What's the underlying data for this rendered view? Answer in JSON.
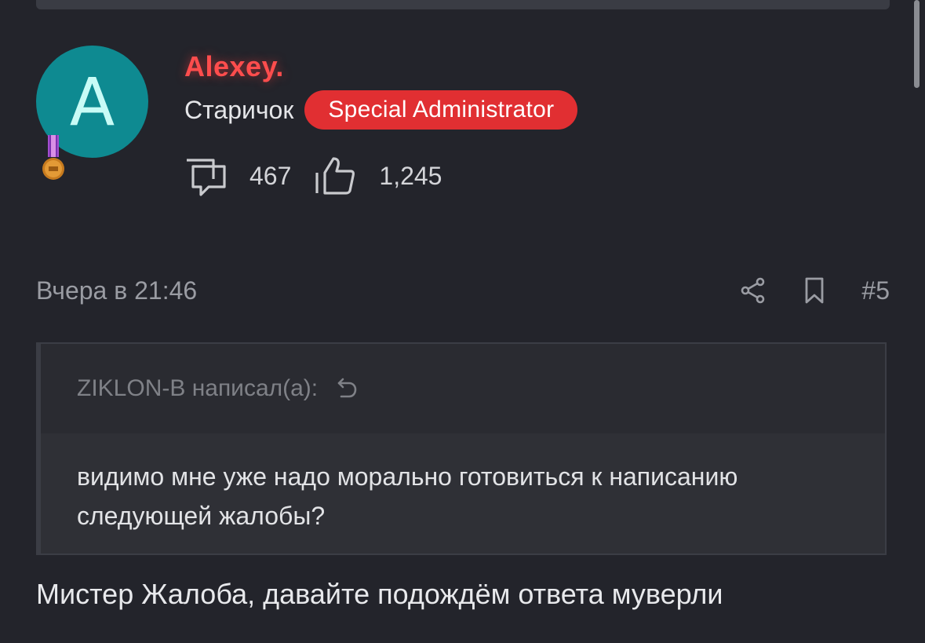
{
  "user": {
    "avatar_letter": "A",
    "name": "Alexey.",
    "title": "Старичок",
    "role_badge": "Special Administrator",
    "stats": {
      "messages": "467",
      "reactions": "1,245"
    },
    "colors": {
      "avatar_bg": "#0e8a91",
      "name": "#ff4d4d",
      "badge_bg": "#e12f32"
    }
  },
  "post": {
    "date": "Вчера в 21:46",
    "number": "#5",
    "quote": {
      "author": "ZIKLON-B написал(а):",
      "text": "видимо мне уже надо морально готовиться к написанию следующей жалобы?"
    },
    "text": "Мистер Жалоба, давайте подождём ответа муверли"
  },
  "icons": {
    "messages": "speech-bubble-icon",
    "reactions": "thumbs-up-icon",
    "share": "share-icon",
    "bookmark": "bookmark-icon",
    "quote_jump": "jump-to-quote-icon",
    "medal": "medal-icon"
  }
}
